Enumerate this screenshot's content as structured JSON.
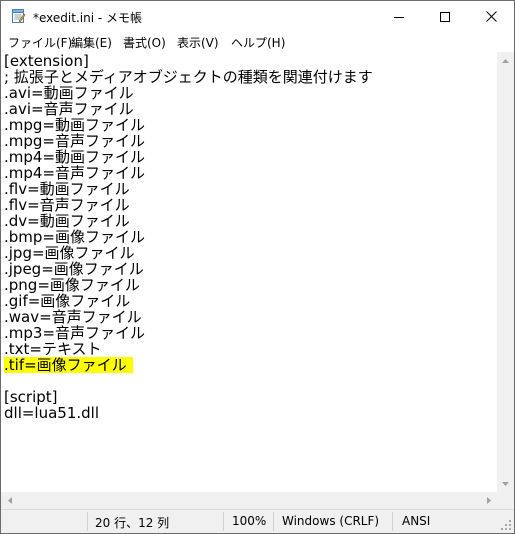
{
  "window": {
    "title": "*exedit.ini - メモ帳",
    "icon": "notepad-icon"
  },
  "menu": [
    "ファイル(F)",
    "編集(E)",
    "書式(O)",
    "表示(V)",
    "ヘルプ(H)"
  ],
  "editor": {
    "lines": [
      "[extension]",
      "; 拡張子とメディアオブジェクトの種類を関連付けます",
      ".avi=動画ファイル",
      ".avi=音声ファイル",
      ".mpg=動画ファイル",
      ".mpg=音声ファイル",
      ".mp4=動画ファイル",
      ".mp4=音声ファイル",
      ".flv=動画ファイル",
      ".flv=音声ファイル",
      ".dv=動画ファイル",
      ".bmp=画像ファイル",
      ".jpg=画像ファイル",
      ".jpeg=画像ファイル",
      ".png=画像ファイル",
      ".gif=画像ファイル",
      ".wav=音声ファイル",
      ".mp3=音声ファイル",
      ".txt=テキスト",
      ".tif=画像ファイル",
      "",
      "[script]",
      "dll=lua51.dll"
    ],
    "highlighted_line": 19,
    "highlight_color": "#ffff00"
  },
  "status": {
    "position": "20 行、12 列",
    "zoom": "100%",
    "line_ending": "Windows (CRLF)",
    "encoding": "ANSI"
  }
}
